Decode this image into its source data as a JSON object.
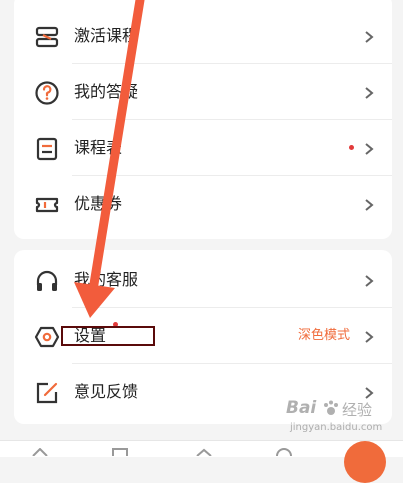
{
  "colors": {
    "accent": "#f06b3b",
    "arrow": "#f25c3c",
    "highlight_box": "#5a0a0a",
    "badge_dot": "#e23a3a"
  },
  "menu_group_1": {
    "items": [
      {
        "label": "激活课程",
        "icon": "ticket-stack-icon"
      },
      {
        "label": "我的答疑",
        "icon": "question-circle-icon"
      },
      {
        "label": "课程表",
        "icon": "schedule-icon",
        "badge": true
      },
      {
        "label": "优惠券",
        "icon": "coupon-icon"
      }
    ]
  },
  "menu_group_2": {
    "items": [
      {
        "label": "我的客服",
        "icon": "headset-icon"
      },
      {
        "label": "设置",
        "icon": "settings-hexagon-icon",
        "right_text": "深色模式"
      },
      {
        "label": "意见反馈",
        "icon": "feedback-edit-icon"
      }
    ]
  },
  "watermark": {
    "brand": "Bai",
    "brand_cn": "经验",
    "url": "jingyan.baidu.com"
  }
}
